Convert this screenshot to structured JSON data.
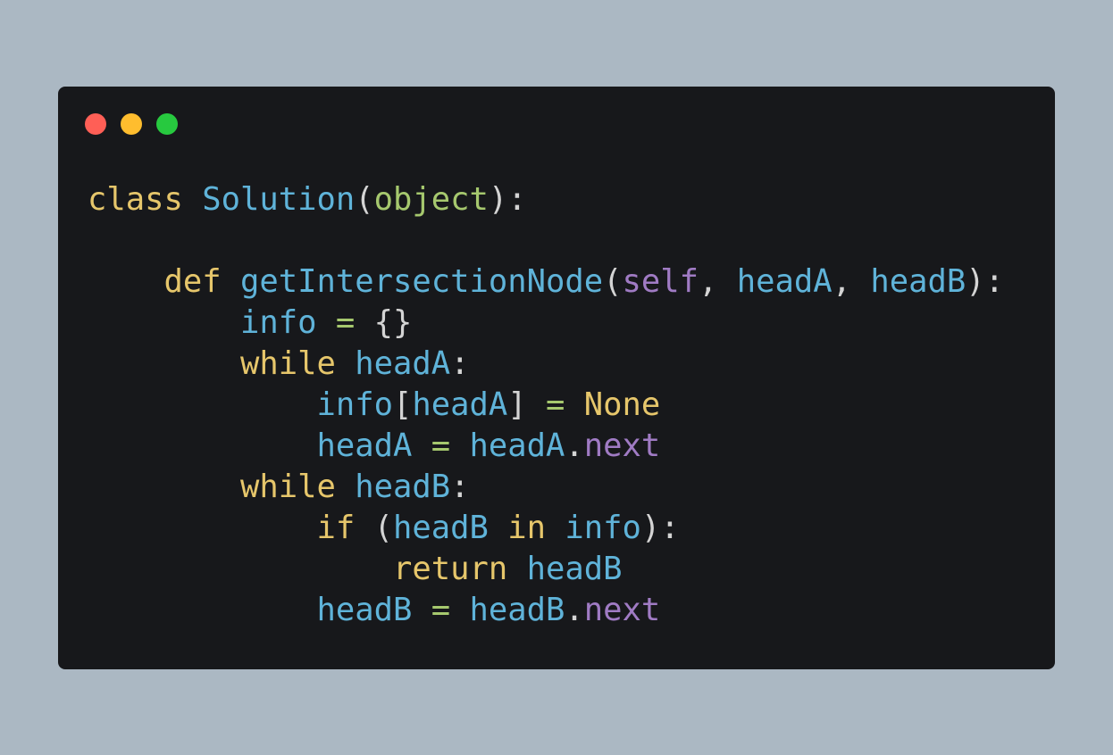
{
  "window": {
    "controls": [
      "close",
      "minimize",
      "maximize"
    ]
  },
  "colors": {
    "background": "#abb8c3",
    "panel": "#17181b",
    "keyword": "#e6c66b",
    "class_name": "#5fb3d9",
    "builtin": "#a6c86e",
    "self": "#a07bc4",
    "identifier": "#5fb3d9",
    "attribute": "#a07bc4",
    "operator": "#a6c86e",
    "constant": "#e6c66b",
    "punctuation": "#d4d4d4"
  },
  "code": {
    "language": "python",
    "lines": [
      [
        {
          "t": "class",
          "k": "keyword"
        },
        {
          "t": " ",
          "k": "punctuation"
        },
        {
          "t": "Solution",
          "k": "class_name"
        },
        {
          "t": "(",
          "k": "punctuation"
        },
        {
          "t": "object",
          "k": "builtin"
        },
        {
          "t": "):",
          "k": "punctuation"
        }
      ],
      [],
      [
        {
          "t": "    ",
          "k": "punctuation"
        },
        {
          "t": "def",
          "k": "keyword"
        },
        {
          "t": " ",
          "k": "punctuation"
        },
        {
          "t": "getIntersectionNode",
          "k": "identifier"
        },
        {
          "t": "(",
          "k": "punctuation"
        },
        {
          "t": "self",
          "k": "self"
        },
        {
          "t": ", ",
          "k": "punctuation"
        },
        {
          "t": "headA",
          "k": "identifier"
        },
        {
          "t": ", ",
          "k": "punctuation"
        },
        {
          "t": "headB",
          "k": "identifier"
        },
        {
          "t": "):",
          "k": "punctuation"
        }
      ],
      [
        {
          "t": "        ",
          "k": "punctuation"
        },
        {
          "t": "info",
          "k": "identifier"
        },
        {
          "t": " ",
          "k": "punctuation"
        },
        {
          "t": "=",
          "k": "operator"
        },
        {
          "t": " {}",
          "k": "punctuation"
        }
      ],
      [
        {
          "t": "        ",
          "k": "punctuation"
        },
        {
          "t": "while",
          "k": "keyword"
        },
        {
          "t": " ",
          "k": "punctuation"
        },
        {
          "t": "headA",
          "k": "identifier"
        },
        {
          "t": ":",
          "k": "punctuation"
        }
      ],
      [
        {
          "t": "            ",
          "k": "punctuation"
        },
        {
          "t": "info",
          "k": "identifier"
        },
        {
          "t": "[",
          "k": "punctuation"
        },
        {
          "t": "headA",
          "k": "identifier"
        },
        {
          "t": "] ",
          "k": "punctuation"
        },
        {
          "t": "=",
          "k": "operator"
        },
        {
          "t": " ",
          "k": "punctuation"
        },
        {
          "t": "None",
          "k": "constant"
        }
      ],
      [
        {
          "t": "            ",
          "k": "punctuation"
        },
        {
          "t": "headA",
          "k": "identifier"
        },
        {
          "t": " ",
          "k": "punctuation"
        },
        {
          "t": "=",
          "k": "operator"
        },
        {
          "t": " ",
          "k": "punctuation"
        },
        {
          "t": "headA",
          "k": "identifier"
        },
        {
          "t": ".",
          "k": "punctuation"
        },
        {
          "t": "next",
          "k": "attribute"
        }
      ],
      [
        {
          "t": "        ",
          "k": "punctuation"
        },
        {
          "t": "while",
          "k": "keyword"
        },
        {
          "t": " ",
          "k": "punctuation"
        },
        {
          "t": "headB",
          "k": "identifier"
        },
        {
          "t": ":",
          "k": "punctuation"
        }
      ],
      [
        {
          "t": "            ",
          "k": "punctuation"
        },
        {
          "t": "if",
          "k": "keyword"
        },
        {
          "t": " (",
          "k": "punctuation"
        },
        {
          "t": "headB",
          "k": "identifier"
        },
        {
          "t": " ",
          "k": "punctuation"
        },
        {
          "t": "in",
          "k": "keyword"
        },
        {
          "t": " ",
          "k": "punctuation"
        },
        {
          "t": "info",
          "k": "identifier"
        },
        {
          "t": "):",
          "k": "punctuation"
        }
      ],
      [
        {
          "t": "                ",
          "k": "punctuation"
        },
        {
          "t": "return",
          "k": "keyword"
        },
        {
          "t": " ",
          "k": "punctuation"
        },
        {
          "t": "headB",
          "k": "identifier"
        }
      ],
      [
        {
          "t": "            ",
          "k": "punctuation"
        },
        {
          "t": "headB",
          "k": "identifier"
        },
        {
          "t": " ",
          "k": "punctuation"
        },
        {
          "t": "=",
          "k": "operator"
        },
        {
          "t": " ",
          "k": "punctuation"
        },
        {
          "t": "headB",
          "k": "identifier"
        },
        {
          "t": ".",
          "k": "punctuation"
        },
        {
          "t": "next",
          "k": "attribute"
        }
      ]
    ]
  }
}
